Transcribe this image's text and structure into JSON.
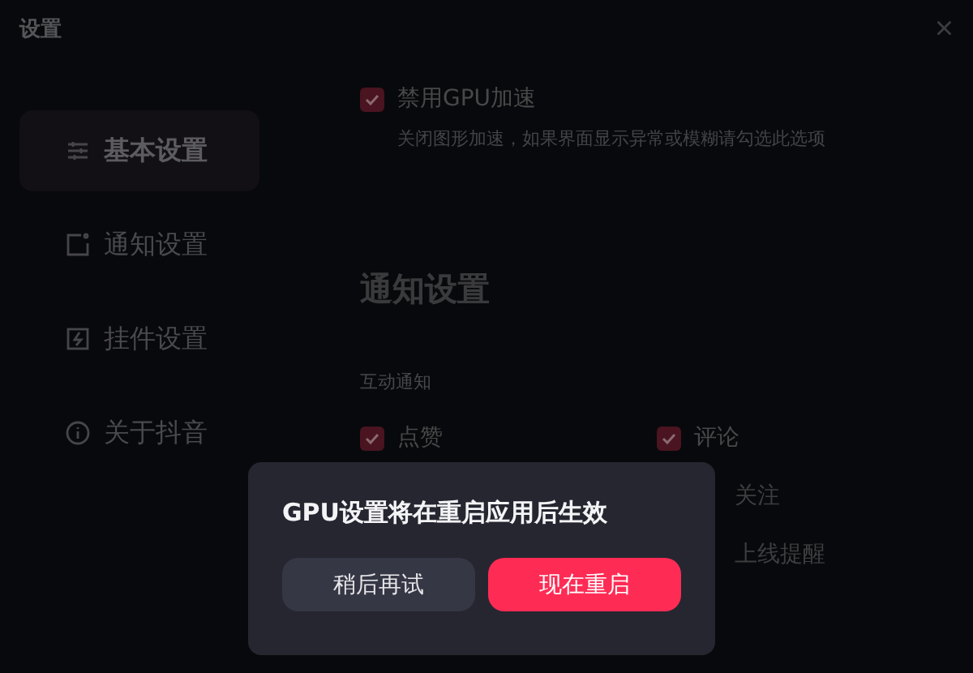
{
  "window": {
    "title": "设置",
    "close": "×"
  },
  "sidebar": {
    "items": [
      {
        "label": "基本设置",
        "selected": true
      },
      {
        "label": "通知设置",
        "selected": false
      },
      {
        "label": "挂件设置",
        "selected": false
      },
      {
        "label": "关于抖音",
        "selected": false
      }
    ]
  },
  "gpu_option": {
    "label": "禁用GPU加速",
    "checked": true,
    "description": "关闭图形加速，如果界面显示异常或模糊请勾选此选项"
  },
  "notifications": {
    "heading": "通知设置",
    "group_label": "互动通知",
    "options": [
      {
        "label": "点赞",
        "checked": true
      },
      {
        "label": "评论",
        "checked": true
      }
    ],
    "covered_labels": [
      "关注",
      "上线提醒"
    ]
  },
  "dialog": {
    "message": "GPU设置将在重启应用后生效",
    "buttons": [
      {
        "label": "稍后再试",
        "kind": "secondary"
      },
      {
        "label": "现在重启",
        "kind": "primary"
      }
    ]
  }
}
